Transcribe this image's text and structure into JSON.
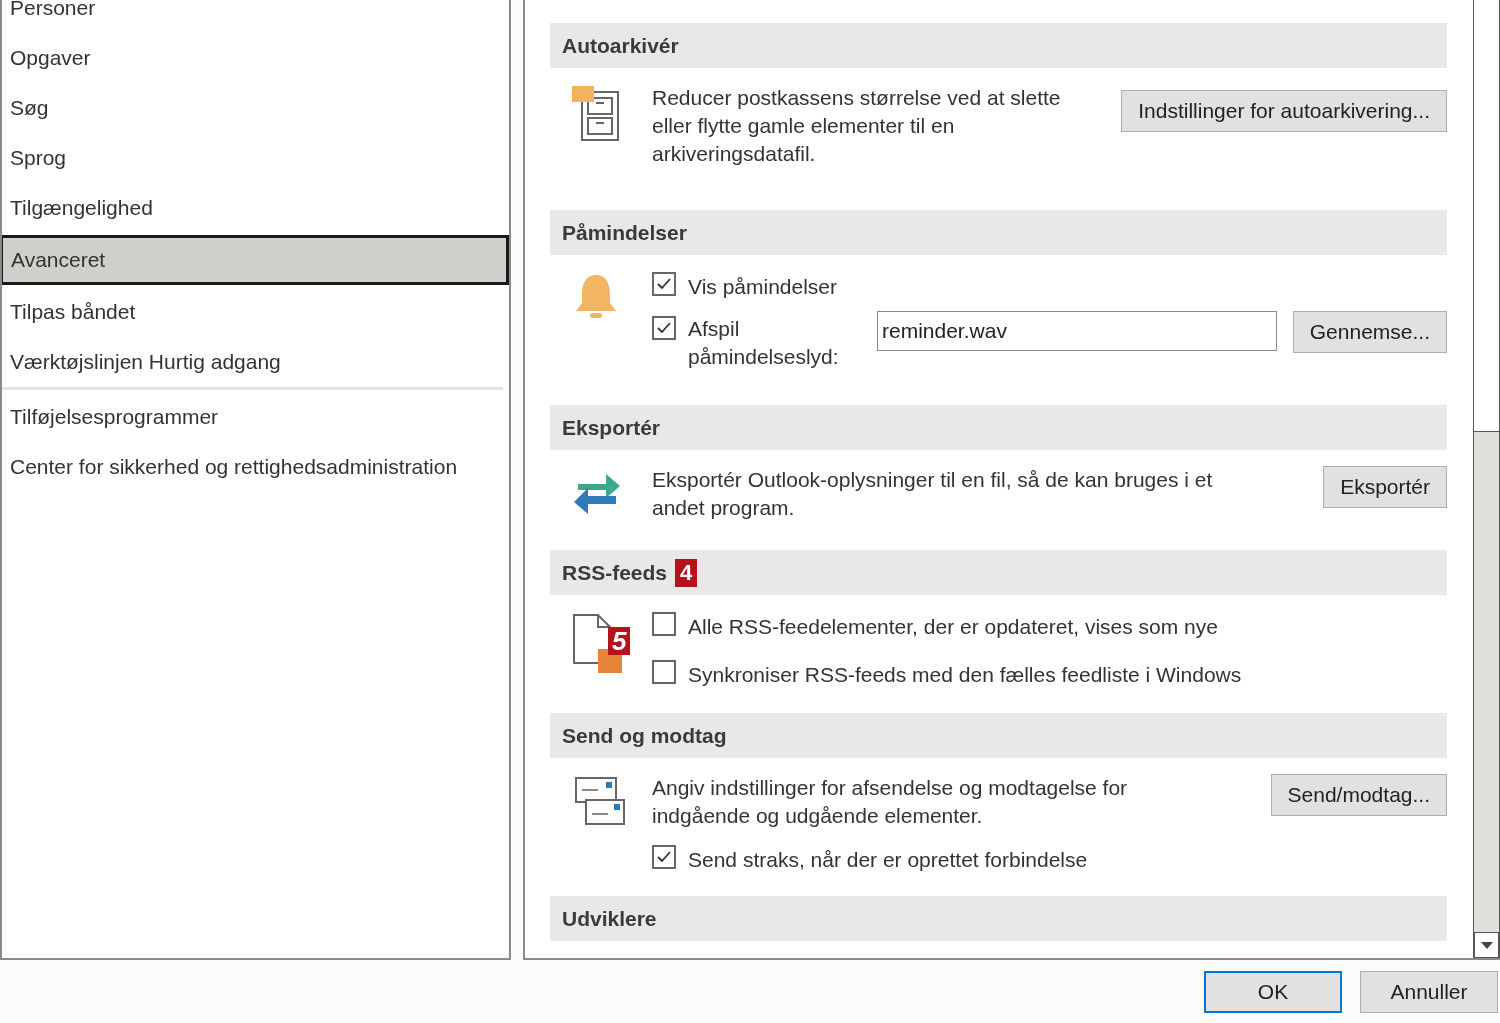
{
  "sidebar": {
    "groups": [
      [
        {
          "label": "Personer",
          "selected": false
        },
        {
          "label": "Opgaver",
          "selected": false
        },
        {
          "label": "Søg",
          "selected": false
        },
        {
          "label": "Sprog",
          "selected": false
        },
        {
          "label": "Tilgængelighed",
          "selected": false
        },
        {
          "label": "Avanceret",
          "selected": true
        },
        {
          "label": "Tilpas båndet",
          "selected": false
        },
        {
          "label": "Værktøjslinjen Hurtig adgang",
          "selected": false
        }
      ],
      [
        {
          "label": "Tilføjelsesprogrammer",
          "selected": false
        },
        {
          "label": "Center for sikkerhed og rettighedsadministration",
          "selected": false
        }
      ]
    ]
  },
  "sections": [
    {
      "kind": "action",
      "title": "Autoarkivér",
      "text": "Reducer postkassens størrelse ved at slette eller flytte gamle elementer til en arkiveringsdatafil.",
      "button": "Indstillinger for autoarkivering..."
    },
    {
      "kind": "reminders",
      "title": "Påmindelser",
      "checks": [
        {
          "label": "Vis påmindelser",
          "checked": true
        },
        {
          "label": "Afspil påmindelseslyd:",
          "checked": true
        }
      ],
      "field": "reminder.wav",
      "button": "Gennemse..."
    },
    {
      "kind": "action",
      "title": "Eksportér",
      "text": "Eksportér Outlook-oplysninger til en fil, så de kan bruges i et andet program.",
      "button": "Eksportér"
    },
    {
      "kind": "checks",
      "title": "RSS-feeds",
      "title_badge": "4",
      "icon_badge": "5",
      "checks": [
        {
          "label": "Alle RSS-feedelementer, der er opdateret, vises som nye",
          "checked": false
        },
        {
          "label": "Synkroniser RSS-feeds med den fælles feedliste i Windows",
          "checked": false
        }
      ]
    },
    {
      "kind": "action",
      "title": "Send og modtag",
      "text": "Angiv indstillinger for afsendelse og modtagelse for indgående og udgående elementer.",
      "button": "Send/modtag...",
      "checks": [
        {
          "label": "Send straks, når der er oprettet forbindelse",
          "checked": true
        }
      ]
    },
    {
      "kind": "header",
      "title": "Udviklere"
    }
  ],
  "footer": {
    "buttons": [
      {
        "label": "OK",
        "default": true
      },
      {
        "label": "Annuller",
        "default": false
      }
    ]
  }
}
